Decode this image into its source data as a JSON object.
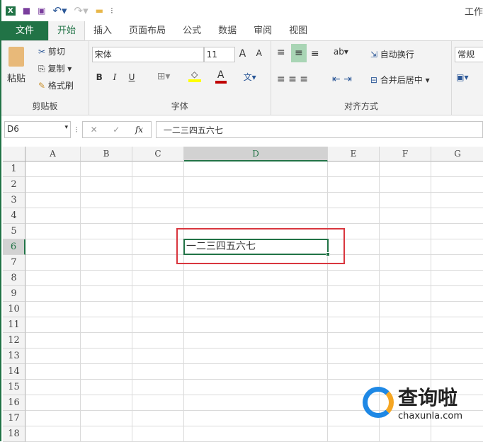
{
  "title": "工作",
  "tabs": [
    "文件",
    "开始",
    "插入",
    "页面布局",
    "公式",
    "数据",
    "审阅",
    "视图"
  ],
  "clipboard": {
    "paste": "粘贴",
    "cut": "剪切",
    "copy": "复制",
    "format_painter": "格式刷",
    "label": "剪贴板"
  },
  "font": {
    "name": "宋体",
    "size": "11",
    "bold": "B",
    "italic": "I",
    "underline": "U",
    "label": "字体"
  },
  "alignment": {
    "wrap": "自动换行",
    "merge": "合并后居中",
    "label": "对齐方式"
  },
  "number": {
    "format": "常规"
  },
  "formula_bar": {
    "name_box": "D6",
    "fx": "fx",
    "value": "一二三四五六七"
  },
  "columns": [
    "A",
    "B",
    "C",
    "D",
    "E",
    "F",
    "G"
  ],
  "rows": [
    "1",
    "2",
    "3",
    "4",
    "5",
    "6",
    "7",
    "8",
    "9",
    "10",
    "11",
    "12",
    "13",
    "14",
    "15",
    "16",
    "17",
    "18"
  ],
  "cell_d6": "一二三四五六七",
  "watermark": {
    "name": "查询啦",
    "url": "chaxunla.com"
  },
  "colors": {
    "accent": "#217346",
    "highlight": "#d9363e"
  }
}
